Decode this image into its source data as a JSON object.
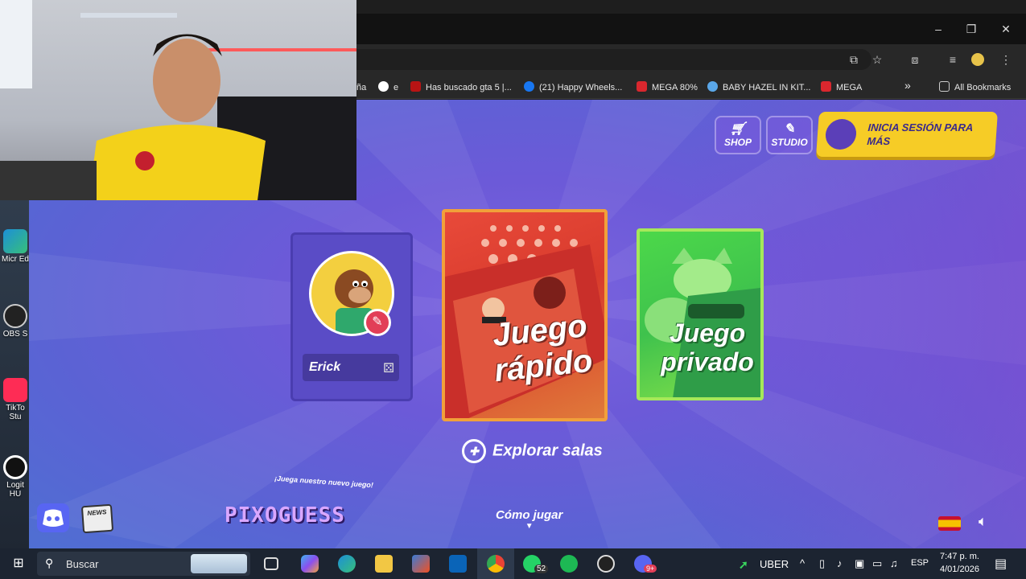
{
  "browser": {
    "window_controls": {
      "minimize": "–",
      "maximize": "❐",
      "close": "✕"
    },
    "bookmarks": [
      {
        "label": "ña",
        "color": "#282828"
      },
      {
        "label": "e",
        "color": "#ffffff"
      },
      {
        "label": "Has buscado gta 5 |...",
        "color": "#b81414"
      },
      {
        "label": "(21) Happy Wheels...",
        "color": "#1877f2"
      },
      {
        "label": "MEGA 80%",
        "color": "#d9272e"
      },
      {
        "label": "BABY HAZEL IN KIT...",
        "color": "#5aa7e8"
      },
      {
        "label": "MEGA",
        "color": "#d9272e"
      }
    ],
    "more_bookmarks": "»",
    "all_bookmarks": "All Bookmarks"
  },
  "game": {
    "top_buttons": {
      "shop": "SHOP",
      "studio": "STUDIO",
      "login": "INICIA SESIÓN PARA MÁS"
    },
    "profile": {
      "name": "Erick"
    },
    "cards": {
      "quick": [
        "Juego",
        "rápido"
      ],
      "private": [
        "Juego",
        "privado"
      ]
    },
    "explore": "Explorar salas",
    "promo": "¡Juega nuestro nuevo juego!",
    "promo_game": "PIXOGUESS",
    "how_to_play": "Cómo jugar",
    "news": "NEWS"
  },
  "desktop": {
    "icons": [
      "Micr Ed",
      "OBS S",
      "TikTo Stu",
      "Logit HU"
    ]
  },
  "taskbar": {
    "search_placeholder": "Buscar",
    "whatsapp_badge": "52",
    "discord_badge": "9+",
    "tray_app": "UBER",
    "language": "ESP",
    "time": "7:47 p. m.",
    "date": "4/01/2026"
  },
  "colors": {
    "brand_purple": "#6c5ad8",
    "gold": "#f6cc26",
    "quick_red": "#e84a3a",
    "private_green": "#4cd84a"
  }
}
